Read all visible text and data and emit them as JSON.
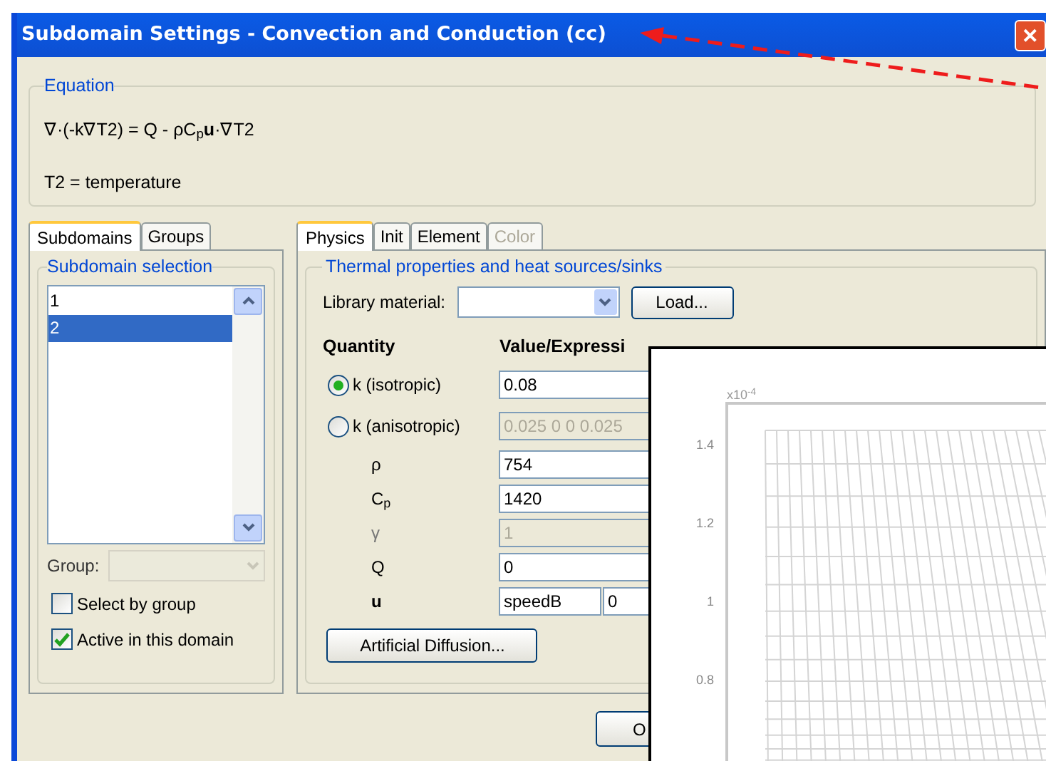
{
  "window": {
    "title": "Subdomain Settings - Convection and Conduction (cc)",
    "close_button": "✕"
  },
  "equation": {
    "title": "Equation",
    "formula": "∇·(-k∇T2) = Q - ρC$_{p}$**u**·∇T2",
    "note": "T2 = temperature"
  },
  "left_tabs": [
    {
      "label": "Subdomains",
      "selected": true
    },
    {
      "label": "Groups",
      "selected": false
    }
  ],
  "subdomain_selection": {
    "title": "Subdomain selection",
    "items": [
      {
        "label": "1",
        "selected": false
      },
      {
        "label": "2",
        "selected": true
      }
    ],
    "group_label": "Group:",
    "checkboxes": [
      {
        "label": "Select by group",
        "checked": false
      },
      {
        "label": "Active in this domain",
        "checked": true
      }
    ]
  },
  "right_tabs": [
    {
      "label": "Physics",
      "selected": true,
      "disabled": false
    },
    {
      "label": "Init",
      "selected": false,
      "disabled": false
    },
    {
      "label": "Element",
      "selected": false,
      "disabled": false
    },
    {
      "label": "Color",
      "selected": false,
      "disabled": true
    }
  ],
  "physics": {
    "title": "Thermal properties and heat sources/sinks",
    "library_label": "Library material:",
    "load_button": "Load...",
    "columns": [
      "Quantity",
      "Value/Expressi"
    ],
    "rows": [
      {
        "kind": "radio",
        "label": "k (isotropic)",
        "selected": true,
        "disabled": false,
        "values": [
          "0.08"
        ]
      },
      {
        "kind": "radio",
        "label": "k (anisotropic)",
        "selected": false,
        "disabled": true,
        "values": [
          "0.025 0 0 0.025"
        ]
      },
      {
        "kind": "plain",
        "label": "ρ",
        "disabled": false,
        "values": [
          "754"
        ]
      },
      {
        "kind": "plain",
        "label": "C$_{p}$",
        "disabled": false,
        "values": [
          "1420"
        ]
      },
      {
        "kind": "plain",
        "label": "γ",
        "disabled": true,
        "values": [
          "1"
        ]
      },
      {
        "kind": "plain",
        "label": "Q",
        "disabled": false,
        "values": [
          "0"
        ]
      },
      {
        "kind": "vector",
        "label": "u",
        "disabled": false,
        "values": [
          "speedB",
          "0"
        ]
      }
    ],
    "diffusion_button": "Artificial Diffusion..."
  },
  "ok_button": "O",
  "plot_window": {
    "scale_label": "x10$^{-4}$",
    "yticks": [
      "1.4",
      "1.2",
      "1",
      "0.8"
    ]
  }
}
